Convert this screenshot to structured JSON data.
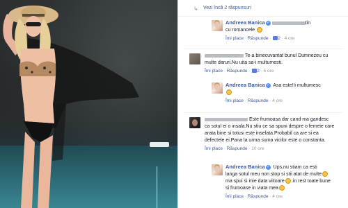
{
  "thread": {
    "more_replies": "Vezi încă 2 răspunsuri",
    "like_label": "Îmi place",
    "reply_label": "Răspunde",
    "items": [
      {
        "author": "Andreea Banica",
        "text_tail": "tin",
        "text_2": "cu romancele",
        "likes": "2",
        "age": "4 ore"
      },
      {
        "author": "",
        "text_1": "Te-a binecuvantat bunul Dumnezeu cu",
        "text_2": "multe daruri.Nu uita sa-i multumesti.",
        "likes": "2",
        "age": "5 ore"
      },
      {
        "author": "Andreea Banica",
        "text_1": "Asa este!!i multumesc",
        "likes": "",
        "age": "4 ore"
      },
      {
        "author": "",
        "text_1": "Este frumoasa dar cand ma gandesc",
        "text_2": "ca sotul ei o insala.Nu stiu ce sa spuni despre o femeie care",
        "text_3": "arata bine si totusi este inselata.Probabil ca are si ea",
        "text_4": "defectele ei.Pana la urma suma vicilor este o constanta.",
        "likes": "",
        "age": "10 ore"
      },
      {
        "author": "Andreea Banica",
        "text_1": "Ups,nu stiam ca esti",
        "text_2": "langa sotul meu non stop si stii atat de multe",
        "text_3": "ma spui si mie data viitoare",
        "text_3b": ".in rest toate bune",
        "text_4": "si frumoase in viata mea",
        "likes": "",
        "age": "4 ore"
      }
    ]
  },
  "colors": {
    "link": "#3b5998",
    "meta": "#9197a3",
    "verified": "#5890ff"
  }
}
